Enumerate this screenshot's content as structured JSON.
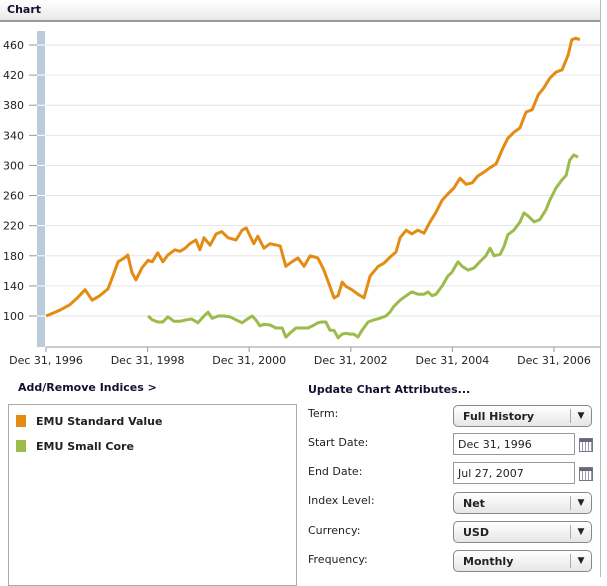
{
  "header": {
    "title": "Chart"
  },
  "chart_data": {
    "type": "line",
    "x_unit": "years since Dec 31, 1996",
    "xlim": [
      0,
      10.6
    ],
    "ylim": [
      70,
      480
    ],
    "yticks": [
      100,
      140,
      180,
      220,
      260,
      300,
      340,
      380,
      420,
      460
    ],
    "xticks": [
      {
        "x": 0,
        "label": "Dec 31, 1996"
      },
      {
        "x": 2,
        "label": "Dec 31, 1998"
      },
      {
        "x": 4,
        "label": "Dec 31, 2000"
      },
      {
        "x": 6,
        "label": "Dec 31, 2002"
      },
      {
        "x": 8,
        "label": "Dec 31, 2004"
      },
      {
        "x": 10,
        "label": "Dec 31, 2006"
      }
    ],
    "grid": true,
    "series": [
      {
        "name": "EMU Standard Value",
        "color": "#e38b12",
        "x": [
          0,
          0.18,
          0.31,
          0.47,
          0.63,
          0.77,
          0.91,
          1.06,
          1.22,
          1.3,
          1.42,
          1.54,
          1.61,
          1.69,
          1.77,
          1.89,
          2.01,
          2.09,
          2.2,
          2.3,
          2.4,
          2.54,
          2.64,
          2.74,
          2.83,
          2.95,
          3.03,
          3.11,
          3.23,
          3.35,
          3.46,
          3.58,
          3.74,
          3.86,
          3.94,
          4.09,
          4.17,
          4.29,
          4.41,
          4.61,
          4.72,
          4.84,
          4.96,
          5.08,
          5.2,
          5.35,
          5.47,
          5.59,
          5.67,
          5.75,
          5.83,
          5.91,
          6.02,
          6.14,
          6.26,
          6.38,
          6.54,
          6.65,
          6.77,
          6.89,
          6.97,
          7.09,
          7.2,
          7.32,
          7.44,
          7.56,
          7.68,
          7.8,
          7.91,
          8.03,
          8.15,
          8.27,
          8.39,
          8.5,
          8.62,
          8.74,
          8.86,
          8.98,
          9.09,
          9.21,
          9.33,
          9.45,
          9.57,
          9.69,
          9.8,
          9.92,
          10.04,
          10.16,
          10.28,
          10.35,
          10.43,
          10.51
        ],
        "y": [
          100,
          105,
          109,
          115,
          125,
          135,
          121,
          127,
          136,
          150,
          172,
          177,
          181,
          158,
          148,
          164,
          174,
          172,
          184,
          172,
          181,
          188,
          186,
          190,
          196,
          201,
          188,
          204,
          194,
          209,
          212,
          204,
          201,
          214,
          217,
          196,
          206,
          190,
          196,
          193,
          166,
          172,
          177,
          166,
          180,
          177,
          161,
          139,
          124,
          127,
          145,
          139,
          135,
          129,
          124,
          153,
          166,
          170,
          178,
          185,
          204,
          214,
          209,
          214,
          210,
          225,
          238,
          254,
          262,
          270,
          283,
          275,
          277,
          286,
          291,
          297,
          302,
          321,
          336,
          344,
          350,
          371,
          374,
          394,
          403,
          416,
          424,
          427,
          447,
          467,
          469,
          467
        ]
      },
      {
        "name": "EMU Small Core",
        "color": "#9bbb4a",
        "x": [
          2.01,
          2.09,
          2.2,
          2.3,
          2.4,
          2.52,
          2.64,
          2.76,
          2.87,
          2.99,
          3.11,
          3.19,
          3.27,
          3.39,
          3.5,
          3.62,
          3.74,
          3.86,
          3.94,
          4.06,
          4.13,
          4.21,
          4.29,
          4.41,
          4.53,
          4.65,
          4.72,
          4.8,
          4.92,
          5.04,
          5.16,
          5.28,
          5.35,
          5.43,
          5.51,
          5.59,
          5.67,
          5.75,
          5.83,
          5.91,
          5.98,
          6.06,
          6.14,
          6.22,
          6.34,
          6.46,
          6.57,
          6.69,
          6.77,
          6.85,
          6.97,
          7.09,
          7.2,
          7.32,
          7.44,
          7.52,
          7.6,
          7.68,
          7.8,
          7.91,
          7.99,
          8.11,
          8.19,
          8.31,
          8.43,
          8.54,
          8.66,
          8.74,
          8.82,
          8.94,
          9.02,
          9.09,
          9.21,
          9.33,
          9.41,
          9.49,
          9.61,
          9.72,
          9.84,
          9.92,
          10.04,
          10.16,
          10.24,
          10.31,
          10.39,
          10.47
        ],
        "y": [
          100,
          95,
          92,
          92,
          99,
          93,
          93,
          95,
          96,
          91,
          100,
          105,
          97,
          100,
          100,
          99,
          95,
          91,
          95,
          100,
          95,
          87,
          89,
          88,
          84,
          84,
          72,
          77,
          84,
          84,
          84,
          88,
          91,
          92,
          92,
          81,
          81,
          71,
          76,
          77,
          76,
          76,
          72,
          81,
          92,
          95,
          97,
          100,
          105,
          113,
          121,
          127,
          132,
          129,
          129,
          132,
          127,
          129,
          140,
          153,
          158,
          172,
          166,
          161,
          164,
          172,
          180,
          190,
          180,
          182,
          193,
          208,
          214,
          225,
          237,
          233,
          225,
          228,
          241,
          254,
          270,
          281,
          287,
          307,
          314,
          311
        ]
      }
    ]
  },
  "indices": {
    "title": "Add/Remove Indices >",
    "items": [
      {
        "label": "EMU Standard Value"
      },
      {
        "label": "EMU Small Core"
      }
    ]
  },
  "attributes": {
    "title": "Update Chart Attributes...",
    "term": {
      "label": "Term:",
      "value": "Full History"
    },
    "start": {
      "label": "Start Date:",
      "value": "Dec 31, 1996"
    },
    "end": {
      "label": "End Date:",
      "value": "Jul 27, 2007"
    },
    "index_level": {
      "label": "Index Level:",
      "value": "Net"
    },
    "currency": {
      "label": "Currency:",
      "value": "USD"
    },
    "frequency": {
      "label": "Frequency:",
      "value": "Monthly"
    }
  }
}
